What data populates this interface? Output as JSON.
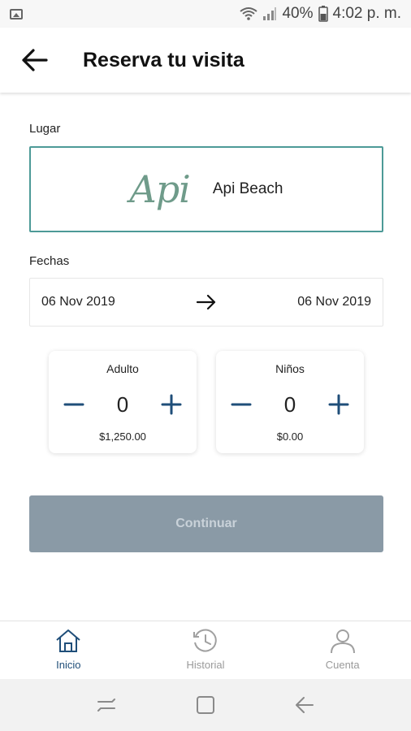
{
  "status_bar": {
    "battery": "40%",
    "time": "4:02 p. m.",
    "icons": [
      "gallery-icon",
      "wifi-icon",
      "signal-icon",
      "battery-icon"
    ]
  },
  "header": {
    "title": "Reserva tu visita",
    "back_icon": "arrow-left-icon"
  },
  "place": {
    "label": "Lugar",
    "logo_text": "Api",
    "name": "Api Beach"
  },
  "dates": {
    "label": "Fechas",
    "start": "06 Nov 2019",
    "end": "06 Nov 2019",
    "arrow_icon": "arrow-right-icon"
  },
  "counters": [
    {
      "title": "Adulto",
      "value": "0",
      "price": "$1,250.00"
    },
    {
      "title": "Niños",
      "value": "0",
      "price": "$0.00"
    }
  ],
  "continue_button": {
    "label": "Continuar",
    "enabled": false
  },
  "bottom_nav": {
    "items": [
      {
        "label": "Inicio",
        "icon": "home-icon",
        "active": true
      },
      {
        "label": "Historial",
        "icon": "history-icon",
        "active": false
      },
      {
        "label": "Cuenta",
        "icon": "account-icon",
        "active": false
      }
    ]
  },
  "colors": {
    "accent": "#4d9a97",
    "nav_active": "#1f4e79",
    "stepper": "#1f4e79",
    "button_disabled": "#8a9aa6"
  }
}
